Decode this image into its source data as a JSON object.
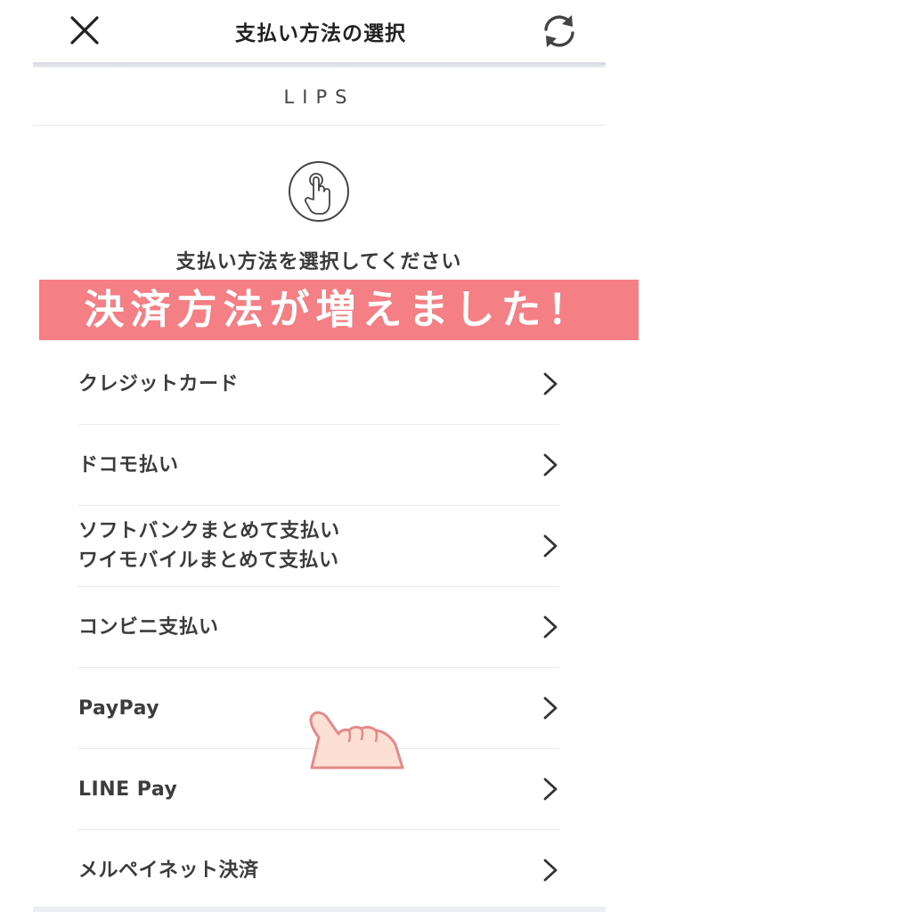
{
  "header": {
    "title": "支払い方法の選択",
    "close_icon": "close-icon",
    "refresh_icon": "refresh-icon"
  },
  "merchant": {
    "name": "LIPS"
  },
  "prompt": {
    "icon": "tap-finger-icon",
    "text": "支払い方法を選択してください"
  },
  "banner": {
    "text": "決済方法が増えました！",
    "color": "#f47f84"
  },
  "methods": [
    {
      "label": "クレジットカード"
    },
    {
      "label": "ドコモ払い"
    },
    {
      "label": "ソフトバンクまとめて支払い\nワイモバイルまとめて支払い"
    },
    {
      "label": "コンビニ支払い"
    },
    {
      "label": "PayPay"
    },
    {
      "label": "LINE Pay"
    },
    {
      "label": "メルペイネット決済"
    }
  ],
  "decoration": {
    "pointer": "pointing-hand-icon",
    "hand_color": "#fbe0d3",
    "outline_color": "#e58a8a"
  }
}
